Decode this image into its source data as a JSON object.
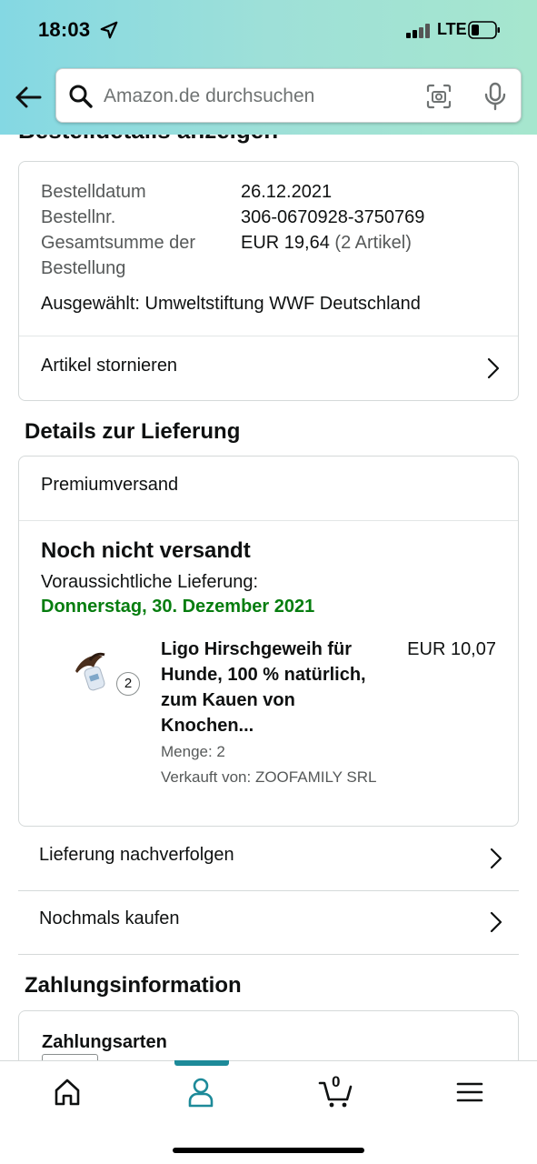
{
  "status_bar": {
    "time": "18:03",
    "network": "LTE"
  },
  "search": {
    "placeholder": "Amazon.de durchsuchen"
  },
  "page": {
    "title_partial": "Bestelldetails anzeigen"
  },
  "order_summary": {
    "date_label": "Bestelldatum",
    "date_value": "26.12.2021",
    "number_label": "Bestellnr.",
    "number_value": "306-0670928-3750769",
    "total_label_line1": "Gesamtsumme der",
    "total_label_line2": "Bestellung",
    "total_value": "EUR 19,64",
    "total_items": "(2 Artikel)",
    "selected_charity": "Ausgewählt: Umweltstiftung WWF Deutschland",
    "cancel_link": "Artikel stornieren"
  },
  "delivery": {
    "section_title": "Details zur Lieferung",
    "shipping_method": "Premiumversand",
    "status": "Noch nicht versandt",
    "eta_label": "Voraussichtliche Lieferung:",
    "eta_date": "Donnerstag, 30. Dezember 2021",
    "item": {
      "title_lines": [
        "Ligo Hirschgeweih für",
        "Hunde, 100 % natürlich,",
        "zum Kauen von",
        "Knochen..."
      ],
      "price": "EUR 10,07",
      "qty_badge": "2",
      "quantity": "Menge: 2",
      "seller": "Verkauft von: ZOOFAMILY SRL"
    },
    "track_link": "Lieferung nachverfolgen",
    "buy_again_link": "Nochmals kaufen"
  },
  "payment": {
    "section_title": "Zahlungsinformation",
    "methods_title": "Zahlungsarten"
  },
  "bottom_nav": {
    "cart_count": "0",
    "active": "account"
  },
  "colors": {
    "delivery_green": "#067d0f",
    "nav_active": "#1d8a99",
    "header_gradient_start": "#84d8e3",
    "header_gradient_end": "#a6e6ce"
  }
}
